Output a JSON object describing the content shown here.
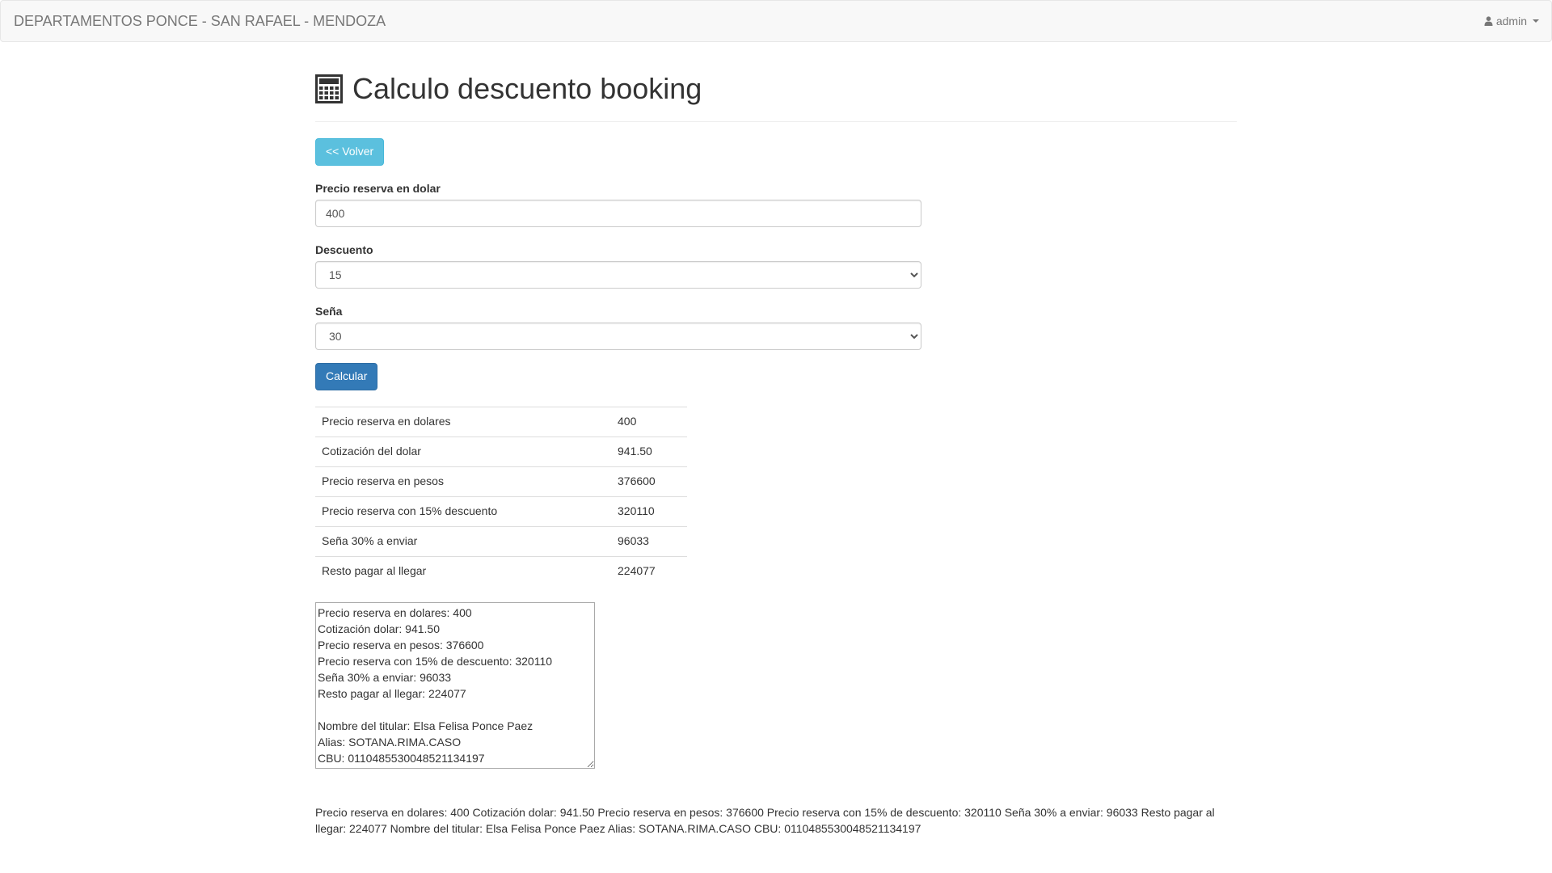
{
  "navbar": {
    "brand": "DEPARTAMENTOS PONCE - SAN RAFAEL - MENDOZA",
    "user": "admin"
  },
  "header": {
    "title": "Calculo descuento booking",
    "icon": "calculator-icon"
  },
  "back_button": "<< Volver",
  "form": {
    "price_label": "Precio reserva en dolar",
    "price_value": "400",
    "discount_label": "Descuento",
    "discount_value": "15",
    "deposit_label": "Seña",
    "deposit_value": "30",
    "calculate_button": "Calcular"
  },
  "results": [
    {
      "label": "Precio reserva en dolares",
      "value": "400"
    },
    {
      "label": "Cotización del dolar",
      "value": "941.50"
    },
    {
      "label": "Precio reserva en pesos",
      "value": "376600"
    },
    {
      "label": "Precio reserva con 15% descuento",
      "value": "320110"
    },
    {
      "label": "Seña 30% a enviar",
      "value": "96033"
    },
    {
      "label": "Resto pagar al llegar",
      "value": "224077"
    }
  ],
  "summary_textarea": "Precio reserva en dolares: 400\nCotización dolar: 941.50\nPrecio reserva en pesos: 376600\nPrecio reserva con 15% de descuento: 320110\nSeña 30% a enviar: 96033\nResto pagar al llegar: 224077\n\nNombre del titular: Elsa Felisa Ponce Paez\nAlias: SOTANA.RIMA.CASO\nCBU: 0110485530048521134197",
  "summary_text": "Precio reserva en dolares: 400 Cotización dolar: 941.50 Precio reserva en pesos: 376600 Precio reserva con 15% de descuento: 320110 Seña 30% a enviar: 96033 Resto pagar al llegar: 224077 Nombre del titular: Elsa Felisa Ponce Paez Alias: SOTANA.RIMA.CASO CBU: 0110485530048521134197",
  "colors": {
    "info": "#5bc0de",
    "primary": "#337ab7",
    "navbar_bg": "#f8f8f8"
  }
}
